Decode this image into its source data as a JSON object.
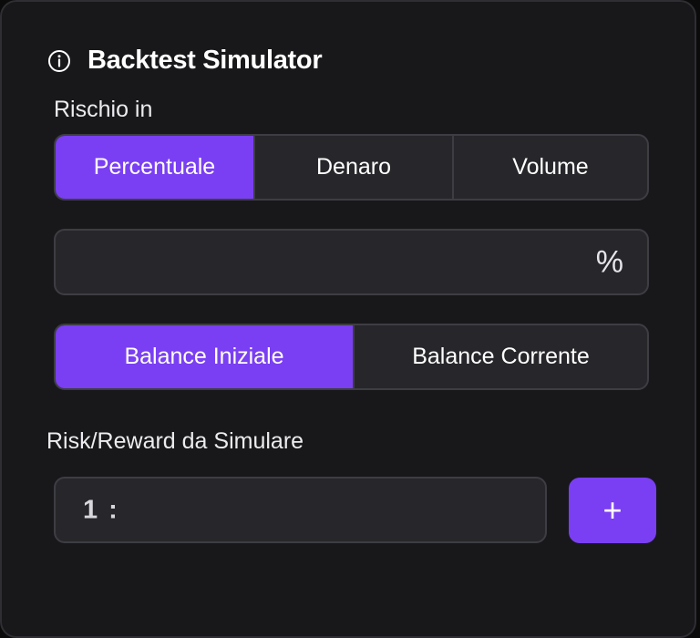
{
  "header": {
    "title": "Backtest Simulator",
    "info_icon": "info-icon"
  },
  "risk": {
    "label": "Rischio in",
    "options": [
      "Percentuale",
      "Denaro",
      "Volume"
    ],
    "selected": "Percentuale"
  },
  "risk_value": {
    "value": "",
    "suffix": "%"
  },
  "balance": {
    "options": [
      "Balance Iniziale",
      "Balance Corrente"
    ],
    "selected": "Balance Iniziale"
  },
  "rr": {
    "label": "Risk/Reward da Simulare",
    "prefix": "1 :",
    "value": "",
    "add_label": "+"
  },
  "colors": {
    "accent": "#7a3ff2",
    "panel": "#18181b",
    "field": "#27272b"
  }
}
